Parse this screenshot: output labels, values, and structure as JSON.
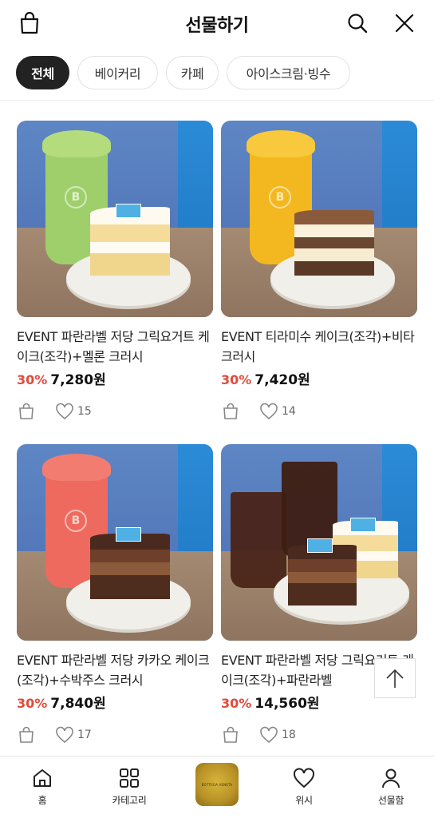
{
  "header": {
    "title": "선물하기",
    "left_icon": "shopping-bag-icon",
    "right_icons": [
      "search-icon",
      "close-icon"
    ]
  },
  "tabs": [
    {
      "label": "전체",
      "active": true
    },
    {
      "label": "베이커리",
      "active": false
    },
    {
      "label": "카페",
      "active": false
    },
    {
      "label": "아이스크림·빙수",
      "active": false
    }
  ],
  "products": [
    {
      "title": "EVENT 파란라벨 저당 그릭요거트 케이크(조각)+멜론 크러시",
      "discount": "30%",
      "price": "7,280원",
      "likes": "15",
      "drink_color": "#9fcf6a",
      "cake": "cheesecake"
    },
    {
      "title": "EVENT 티라미수 케이크(조각)+비타 크러시",
      "discount": "30%",
      "price": "7,420원",
      "likes": "14",
      "drink_color": "#f3b81f",
      "cake": "tiramisu"
    },
    {
      "title": "EVENT 파란라벨 저당 카카오 케이크(조각)+수박주스 크러시",
      "discount": "30%",
      "price": "7,840원",
      "likes": "17",
      "drink_color": "#ee6a5e",
      "cake": "chocolate"
    },
    {
      "title": "EVENT 파란라벨 저당 그릭요거트 케이크(조각)+파란라벨",
      "discount": "30%",
      "price": "14,560원",
      "likes": "18",
      "drink_color": "#4a2418",
      "cake": "duo"
    }
  ],
  "scroll_top_icon": "arrow-up-icon",
  "bottom_nav": {
    "items": [
      {
        "label": "홈",
        "icon": "home-icon"
      },
      {
        "label": "카테고리",
        "icon": "grid-icon"
      },
      {
        "label": "위시",
        "icon": "heart-icon"
      },
      {
        "label": "선물함",
        "icon": "user-icon"
      }
    ],
    "center_brand": "BOTTEGA VENETA"
  }
}
